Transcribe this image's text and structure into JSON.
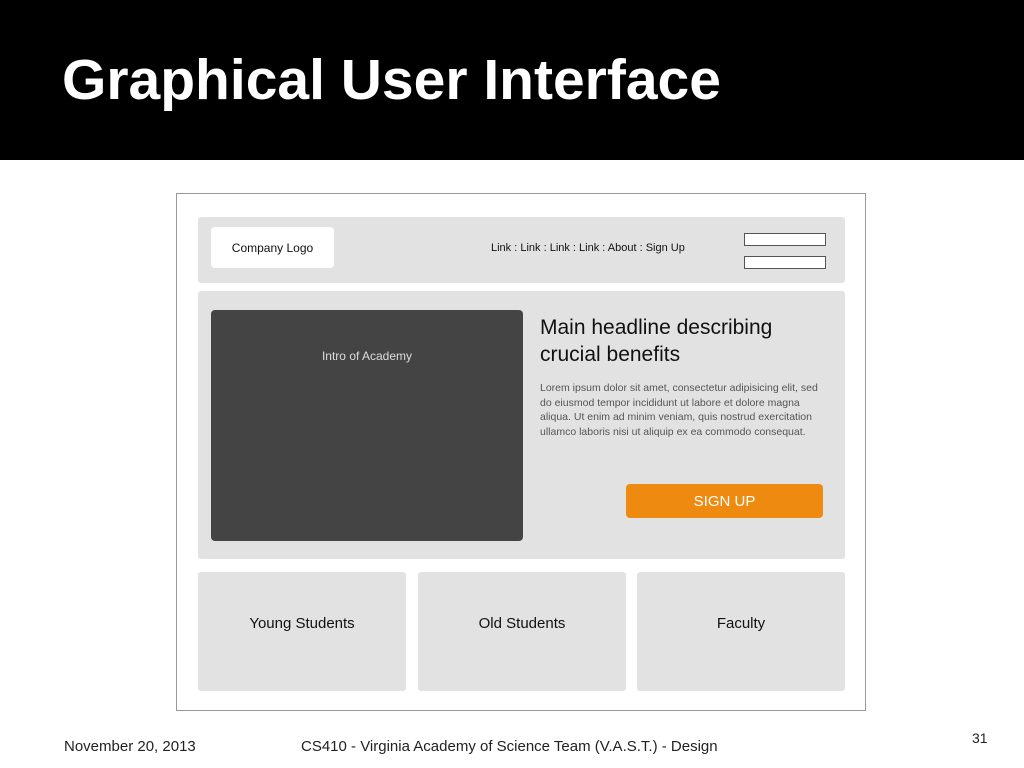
{
  "slide": {
    "title": "Graphical User Interface",
    "footer": {
      "date": "November 20, 2013",
      "course": "CS410 - Virginia Academy of Science Team (V.A.S.T.) - Design",
      "page_number": "31"
    }
  },
  "mockup": {
    "header": {
      "logo_label": "Company Logo",
      "nav_links": "Link  : Link : Link : Link :  About  :  Sign Up"
    },
    "hero": {
      "video_label": "Intro of Academy",
      "headline": "Main headline describing crucial benefits",
      "body": "Lorem ipsum dolor sit amet, consectetur adipisicing elit, sed do eiusmod tempor incididunt ut labore et dolore magna aliqua. Ut enim ad minim veniam, quis nostrud exercitation ullamco laboris nisi ut aliquip ex ea commodo consequat.",
      "cta_label": "SIGN UP"
    },
    "categories": [
      {
        "label": "Young Students"
      },
      {
        "label": "Old Students"
      },
      {
        "label": "Faculty"
      }
    ]
  },
  "colors": {
    "title_bar": "#000000",
    "panel": "#e2e2e2",
    "video_placeholder": "#444444",
    "cta": "#ee8a0f"
  }
}
